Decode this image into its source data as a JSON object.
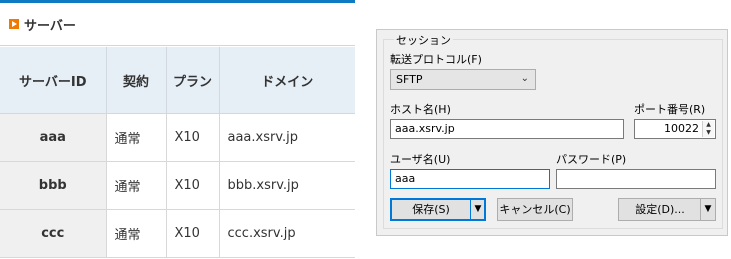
{
  "server_panel": {
    "title": "サーバー",
    "columns": [
      "サーバーID",
      "契約",
      "プラン",
      "ドメイン"
    ],
    "rows": [
      {
        "id": "aaa",
        "contract": "通常",
        "plan": "X10",
        "domain": "aaa.xsrv.jp"
      },
      {
        "id": "bbb",
        "contract": "通常",
        "plan": "X10",
        "domain": "bbb.xsrv.jp"
      },
      {
        "id": "ccc",
        "contract": "通常",
        "plan": "X10",
        "domain": "ccc.xsrv.jp"
      }
    ]
  },
  "session_dialog": {
    "group_label": "セッション",
    "protocol_label": "転送プロトコル(F)",
    "protocol_value": "SFTP",
    "host_label": "ホスト名(H)",
    "host_value": "aaa.xsrv.jp",
    "port_label": "ポート番号(R)",
    "port_value": "10022",
    "user_label": "ユーザ名(U)",
    "user_value": "aaa",
    "password_label": "パスワード(P)",
    "password_value": "",
    "save_button": "保存(S)",
    "cancel_button": "キャンセル(C)",
    "settings_button": "設定(D)..."
  },
  "icons": {
    "header_bullet": "orange-arrow-icon",
    "dropdown": "chevron-down-icon",
    "split": "triangle-down-icon",
    "spin_up": "caret-up-icon",
    "spin_down": "caret-down-icon"
  },
  "colors": {
    "header_accent": "#0e7ac4",
    "bullet": "#f07a00",
    "table_header_bg": "#e6eef6",
    "focus_border": "#0078d7"
  }
}
